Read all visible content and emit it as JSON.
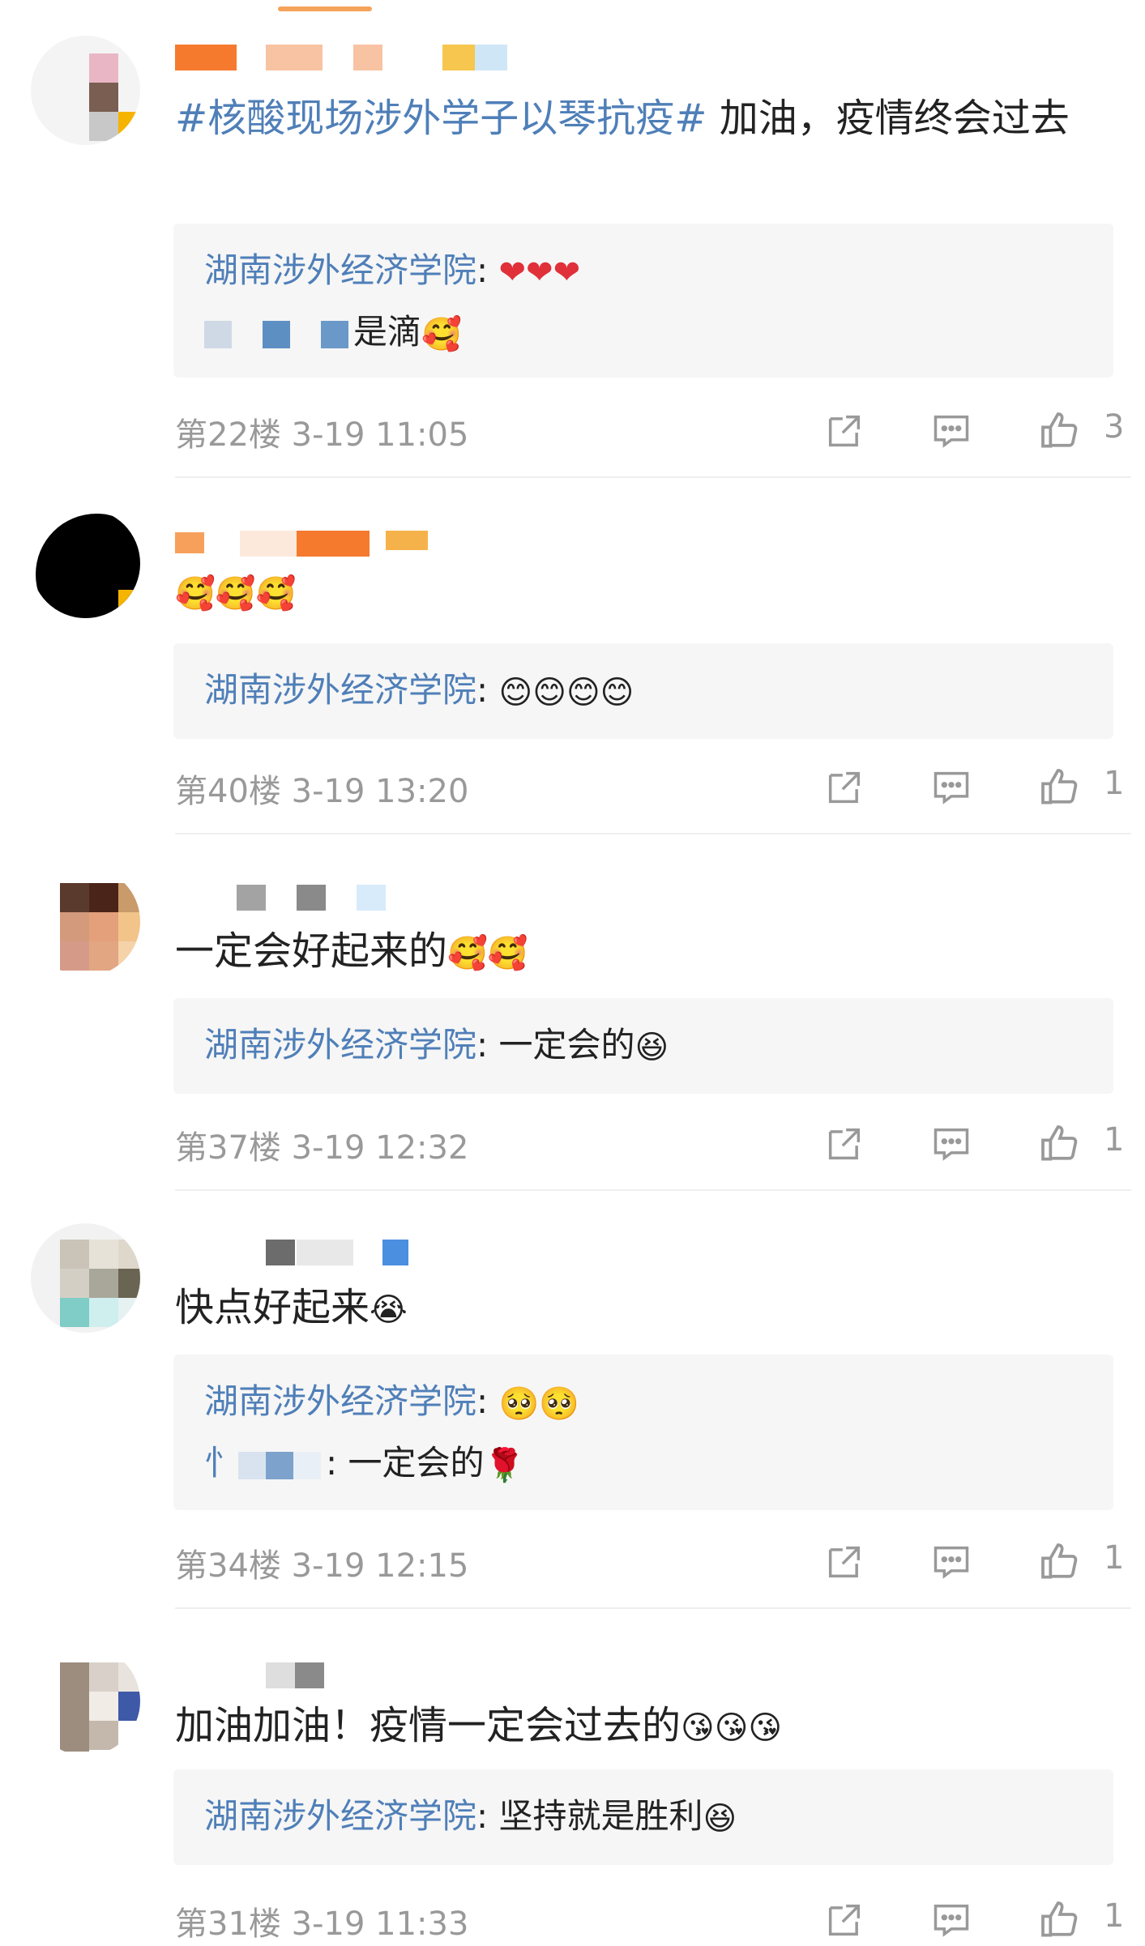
{
  "comments": [
    {
      "body_topic": "#核酸现场涉外学子以琴抗疫#",
      "body_text": " 加油，疫情终会过去",
      "reply": {
        "author": "湖南涉外经济学院",
        "separator": ": ",
        "emojis": [
          "❤",
          "❤",
          "❤"
        ],
        "second_line_text": "是滴",
        "second_line_emoji": "🥰"
      },
      "floor": "第22楼",
      "time": "3-19 11:05",
      "like_count": "3"
    },
    {
      "body_emojis": [
        "🥰",
        "🥰",
        "🥰"
      ],
      "reply": {
        "author": "湖南涉外经济学院",
        "separator": ": ",
        "emojis": [
          "😊",
          "😊",
          "😊",
          "😊"
        ]
      },
      "floor": "第40楼",
      "time": "3-19 13:20",
      "like_count": "1"
    },
    {
      "body_text": "一定会好起来的",
      "body_emojis": [
        "🥰",
        "🥰"
      ],
      "reply": {
        "author": "湖南涉外经济学院",
        "separator": ": ",
        "text": "一定会的",
        "emojis": [
          "😆"
        ]
      },
      "floor": "第37楼",
      "time": "3-19 12:32",
      "like_count": "1"
    },
    {
      "body_text": "快点好起来",
      "body_emojis": [
        "😭"
      ],
      "reply": {
        "author": "湖南涉外经济学院",
        "separator": ": ",
        "emojis": [
          "🥺",
          "🥺"
        ],
        "second_line_prefix": "忄",
        "second_line_text": ": 一定会的",
        "second_line_emoji": "🌹"
      },
      "floor": "第34楼",
      "time": "3-19 12:15",
      "like_count": "1"
    },
    {
      "body_text": "加油加油！疫情一定会过去的",
      "body_emojis": [
        "😘",
        "😘",
        "😘"
      ],
      "reply": {
        "author": "湖南涉外经济学院",
        "separator": ": ",
        "text": "坚持就是胜利",
        "emojis": [
          "😆"
        ]
      },
      "floor": "第31楼",
      "time": "3-19 11:33",
      "like_count": "1"
    }
  ],
  "icons": {
    "share": "share-icon",
    "comment": "comment-icon",
    "like": "thumbs-up-icon"
  },
  "colors": {
    "link_blue": "#4f7fb8",
    "meta_gray": "#999999",
    "reply_bg": "#f6f6f6",
    "text": "#222222"
  }
}
